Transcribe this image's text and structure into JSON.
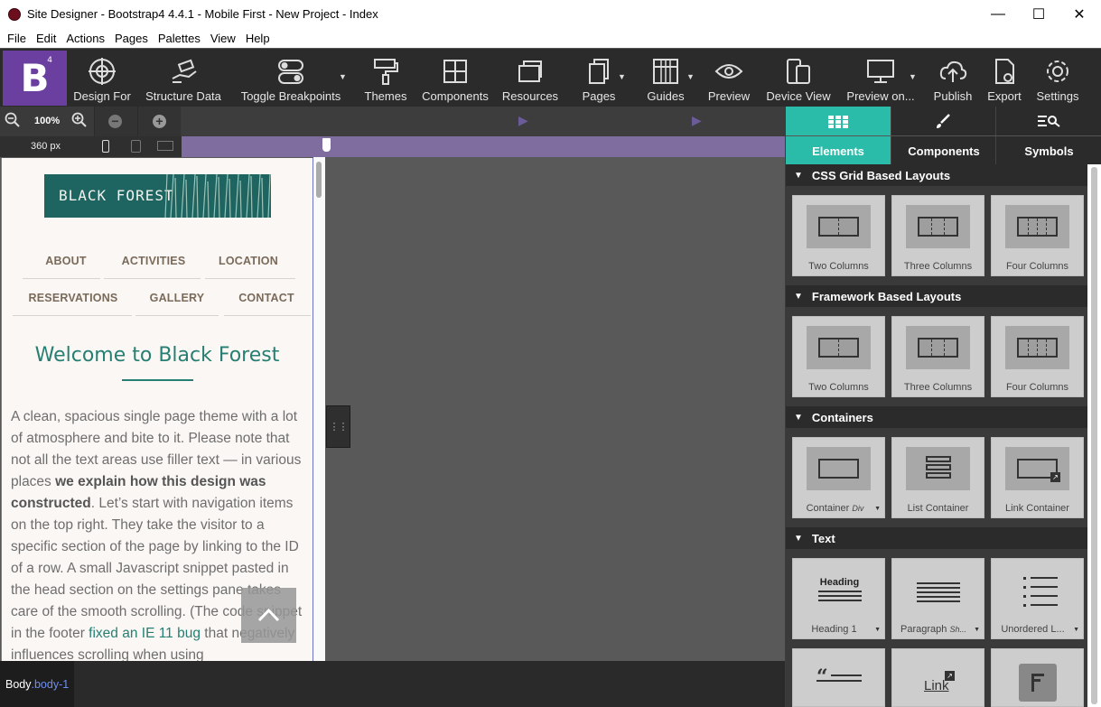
{
  "window": {
    "title": "Site Designer - Bootstrap4 4.4.1 - Mobile First - New Project - Index",
    "min": "—",
    "max": "☐",
    "close": "✕"
  },
  "menu": [
    "File",
    "Edit",
    "Actions",
    "Pages",
    "Palettes",
    "View",
    "Help"
  ],
  "toolbar": {
    "logo": "B",
    "logo_sup": "4",
    "items": [
      "Design For",
      "Structure Data",
      "Toggle Breakpoints",
      "Themes",
      "Components",
      "Resources",
      "Pages",
      "Guides",
      "Preview",
      "Device View",
      "Preview on...",
      "Publish",
      "Export",
      "Settings"
    ]
  },
  "zoom": {
    "level": "100%",
    "width": "360 px"
  },
  "site": {
    "logo_text": "BLACK FOREST",
    "nav": [
      "ABOUT",
      "ACTIVITIES",
      "LOCATION",
      "RESERVATIONS",
      "GALLERY",
      "CONTACT"
    ],
    "heading": "Welcome to Black Forest",
    "p1": "A clean, spacious single page theme with a lot of atmosphere and bite to it. Please note that not all the text areas use filler text — in various places ",
    "p1_bold": "we explain how this design was constructed",
    "p2": ". Let’s start with navigation items on the top right. They take the visitor to a specific section of the page by linking to the ID of a row. A small Javascript snippet pasted in the head section on the settings pane takes care of the smooth scrolling. (The code snippet in the footer ",
    "p2_link": "fixed an IE 11 bug",
    "p3": " that negatively influences scrolling when using"
  },
  "status": {
    "element": "Body",
    "class": ".body-1"
  },
  "panel": {
    "tabs": [
      "Elements",
      "Components",
      "Symbols"
    ],
    "sections": [
      {
        "title": "CSS Grid Based Layouts",
        "items": [
          "Two Columns",
          "Three Columns",
          "Four Columns"
        ]
      },
      {
        "title": "Framework Based Layouts",
        "items": [
          "Two Columns",
          "Three Columns",
          "Four Columns"
        ]
      },
      {
        "title": "Containers",
        "items": [
          "Container",
          "List Container",
          "Link Container"
        ],
        "item_sub": "Div"
      },
      {
        "title": "Text",
        "items": [
          "Heading 1",
          "Paragraph",
          "Unordered L..."
        ],
        "item_sub": "Sh..."
      }
    ],
    "heading_thumb": "Heading",
    "link_thumb": "Link"
  },
  "colors": {
    "accent": "#2bbba9",
    "logo_bg": "#6a3fa0",
    "site_green": "#267f72"
  }
}
